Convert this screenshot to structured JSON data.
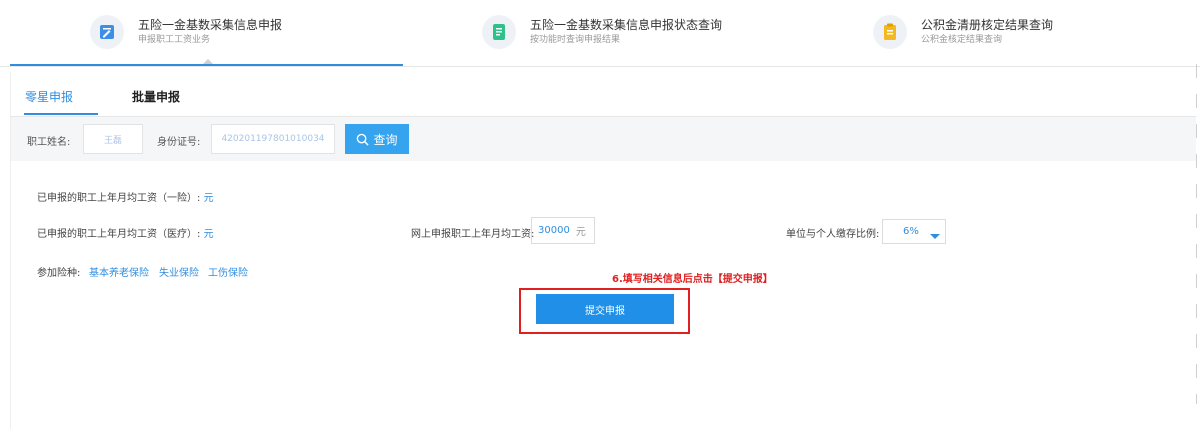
{
  "nav": {
    "items": [
      {
        "title": "五险一金基数采集信息申报",
        "subtitle": "申报职工工资业务",
        "icon": "edit-document-icon",
        "color": "#3d8fe6"
      },
      {
        "title": "五险一金基数采集信息申报状态查询",
        "subtitle": "按功能时查询申报结果",
        "icon": "status-document-icon",
        "color": "#2ec28a"
      },
      {
        "title": "公积金清册核定结果查询",
        "subtitle": "公积金核定结果查询",
        "icon": "note-list-icon",
        "color": "#f4b820"
      }
    ]
  },
  "tabs": [
    {
      "label": "零星申报",
      "active": true
    },
    {
      "label": "批量申报",
      "active": false
    }
  ],
  "search": {
    "name_label": "职工姓名:",
    "name_value": "王磊",
    "id_label": "身份证号:",
    "id_value": "420201197801010034",
    "query_label": "查询",
    "query_icon": "search-icon"
  },
  "form": {
    "pension_label": "已申报的职工上年月均工资（一险）:",
    "pension_unit": "元",
    "medical_label": "已申报的职工上年月均工资（医疗）:",
    "medical_unit": "元",
    "online_label": "网上申报职工上年月均工资:",
    "online_value": "30000",
    "online_unit": "元",
    "ratio_label": "单位与个人缴存比例:",
    "ratio_value": "6%",
    "insurance_label": "参加险种:",
    "insurance_items": [
      "基本养老保险",
      "失业保险",
      "工伤保险"
    ]
  },
  "annotation": "6.填写相关信息后点击【提交申报】",
  "submit_label": "提交申报",
  "colors": {
    "accent": "#2f8ee0",
    "button": "#35a3ee",
    "highlight": "#e02020"
  }
}
